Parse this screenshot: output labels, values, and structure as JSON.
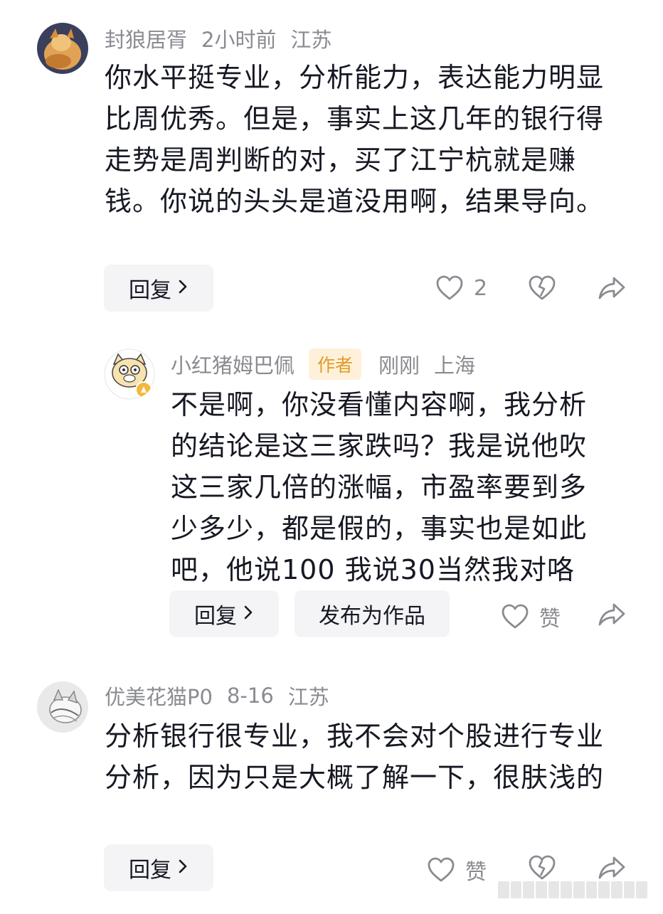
{
  "comments": [
    {
      "username": "封狼居胥",
      "time": "2小时前",
      "location": "江苏",
      "text": "你水平挺专业，分析能力，表达能力明显比周优秀。但是，事实上这几年的银行得走势是周判断的对，买了江宁杭就是赚钱。你说的头头是道没用啊，结果导向。",
      "reply_label": "回复",
      "like_count": "2"
    },
    {
      "username": "小红猪姆巴佩",
      "author_badge": "作者",
      "time": "刚刚",
      "location": "上海",
      "text": "不是啊，你没看懂内容啊，我分析的结论是这三家跌吗？我是说他吹这三家几倍的涨幅，市盈率要到多少多少，都是假的，事实也是如此吧，他说100 我说30当然我对咯",
      "reply_label": "回复",
      "publish_label": "发布为作品",
      "like_label": "赞"
    },
    {
      "username": "优美花猫P0",
      "time": "8-16",
      "location": "江苏",
      "text": "分析银行很专业，我不会对个股进行专业分析，因为只是大概了解一下，很肤浅的",
      "reply_label": "回复",
      "like_label": "赞"
    }
  ],
  "icons": {
    "like": "heart-outline-icon",
    "dislike": "broken-heart-icon",
    "share": "share-arrow-icon",
    "chevron": "chevron-right-icon"
  },
  "colors": {
    "text": "#161823",
    "meta": "#8a8b91",
    "pill_bg": "#f4f4f6",
    "author_badge_bg": "#fff1d9",
    "author_badge_text": "#e09a2a"
  }
}
